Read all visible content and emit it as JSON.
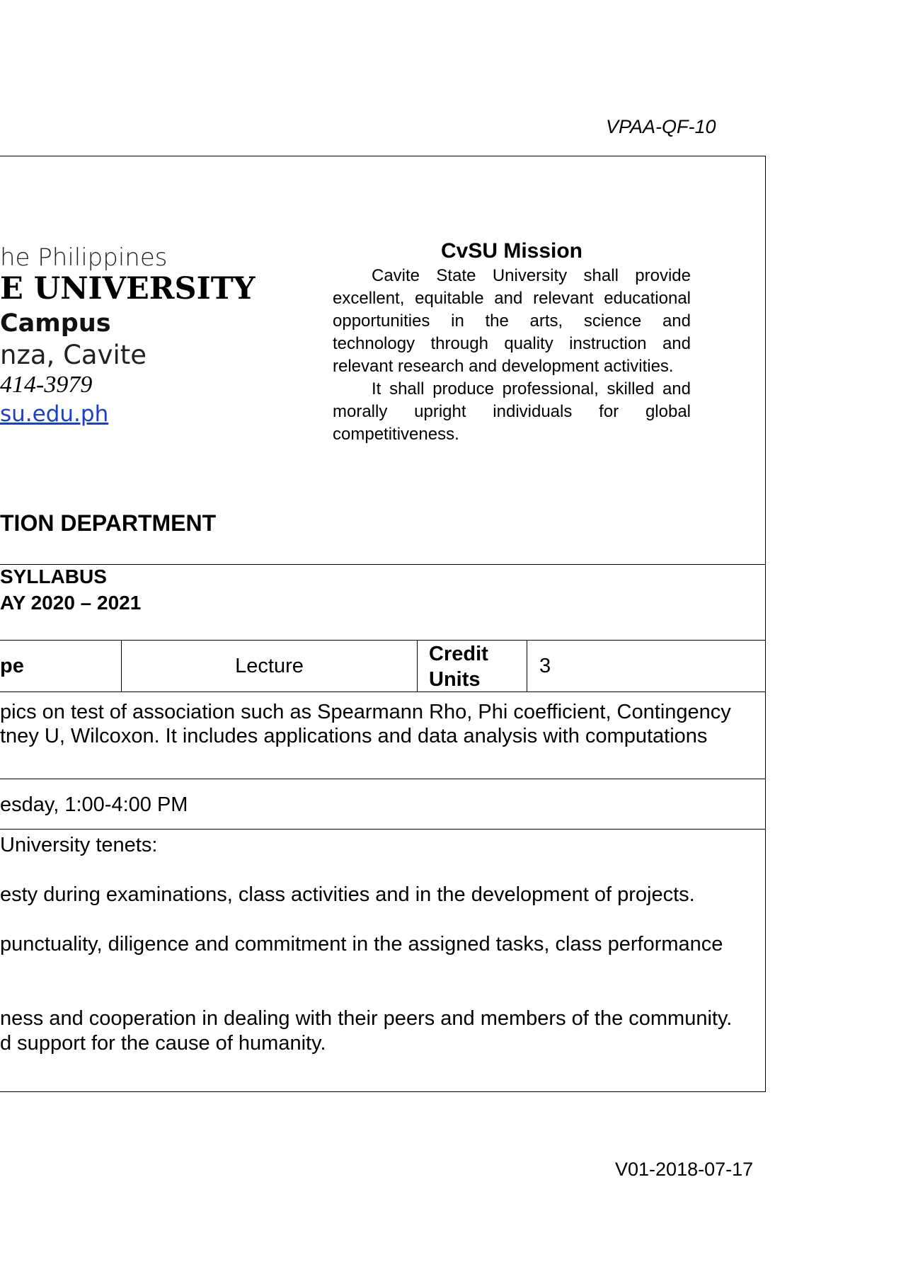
{
  "form_code": "VPAA-QF-10",
  "version_code": "V01-2018-07-17",
  "header": {
    "line1": "he Philippines",
    "line2": "E UNIVERSITY",
    "line3": "Campus",
    "line4": "nza, Cavite",
    "line5": " 414-3979",
    "line6": "su.edu.ph"
  },
  "mission": {
    "title": "CvSU Mission",
    "para1": "Cavite State University shall provide excellent, equitable and relevant educational opportunities in the arts, science and technology through quality instruction and relevant research and development activities.",
    "para2": "It shall produce professional, skilled and morally upright individuals for global competitiveness."
  },
  "department": "TION DEPARTMENT",
  "syllabus": {
    "title": "SYLLABUS",
    "year": "AY 2020 – 2021"
  },
  "course_row": {
    "type_label": "pe",
    "type_value": "Lecture",
    "credit_label_1": "Credit",
    "credit_label_2": "Units",
    "credit_value": "3"
  },
  "description": {
    "line1": "pics on test of association such as Spearmann Rho, Phi coefficient, Contingency",
    "line2": "tney U, Wilcoxon. It includes applications and data analysis with computations"
  },
  "schedule": "esday, 1:00-4:00 PM",
  "tenets": {
    "intro": "University tenets:",
    "item1": "esty during examinations, class activities and in the development of projects.",
    "item2": "punctuality, diligence and commitment in the assigned tasks, class performance",
    "item3a": "ness and cooperation in dealing with their peers and members of the community.",
    "item3b": "d support for the cause of humanity."
  }
}
